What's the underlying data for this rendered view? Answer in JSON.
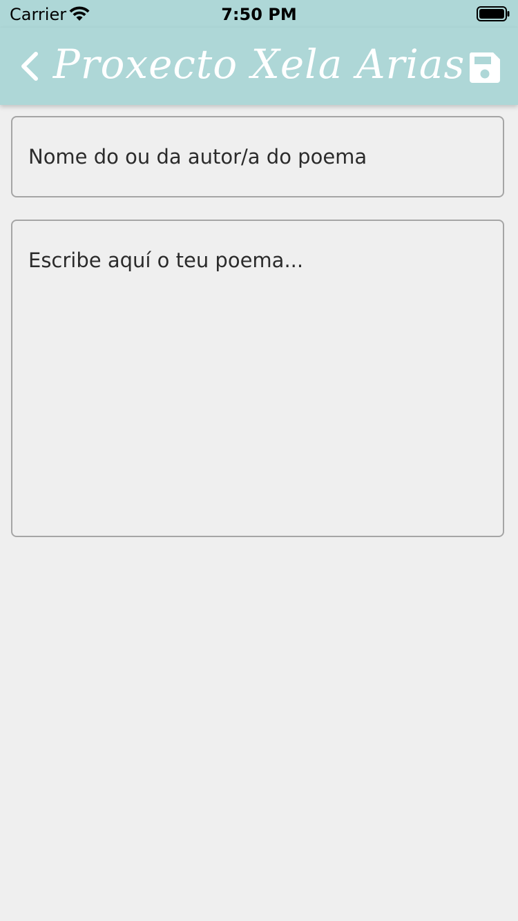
{
  "status_bar": {
    "carrier": "Carrier",
    "time": "7:50 PM",
    "wifi_icon": "wifi-icon",
    "battery_icon": "battery-icon"
  },
  "app_bar": {
    "title": "Proxecto Xela Arias",
    "back_icon": "chevron-left-icon",
    "save_icon": "floppy-disk-icon",
    "background_color": "#aed7d7"
  },
  "form": {
    "author_placeholder": "Nome do ou da autor/a do poema",
    "poem_placeholder": "Escribe aquí o teu poema..."
  }
}
